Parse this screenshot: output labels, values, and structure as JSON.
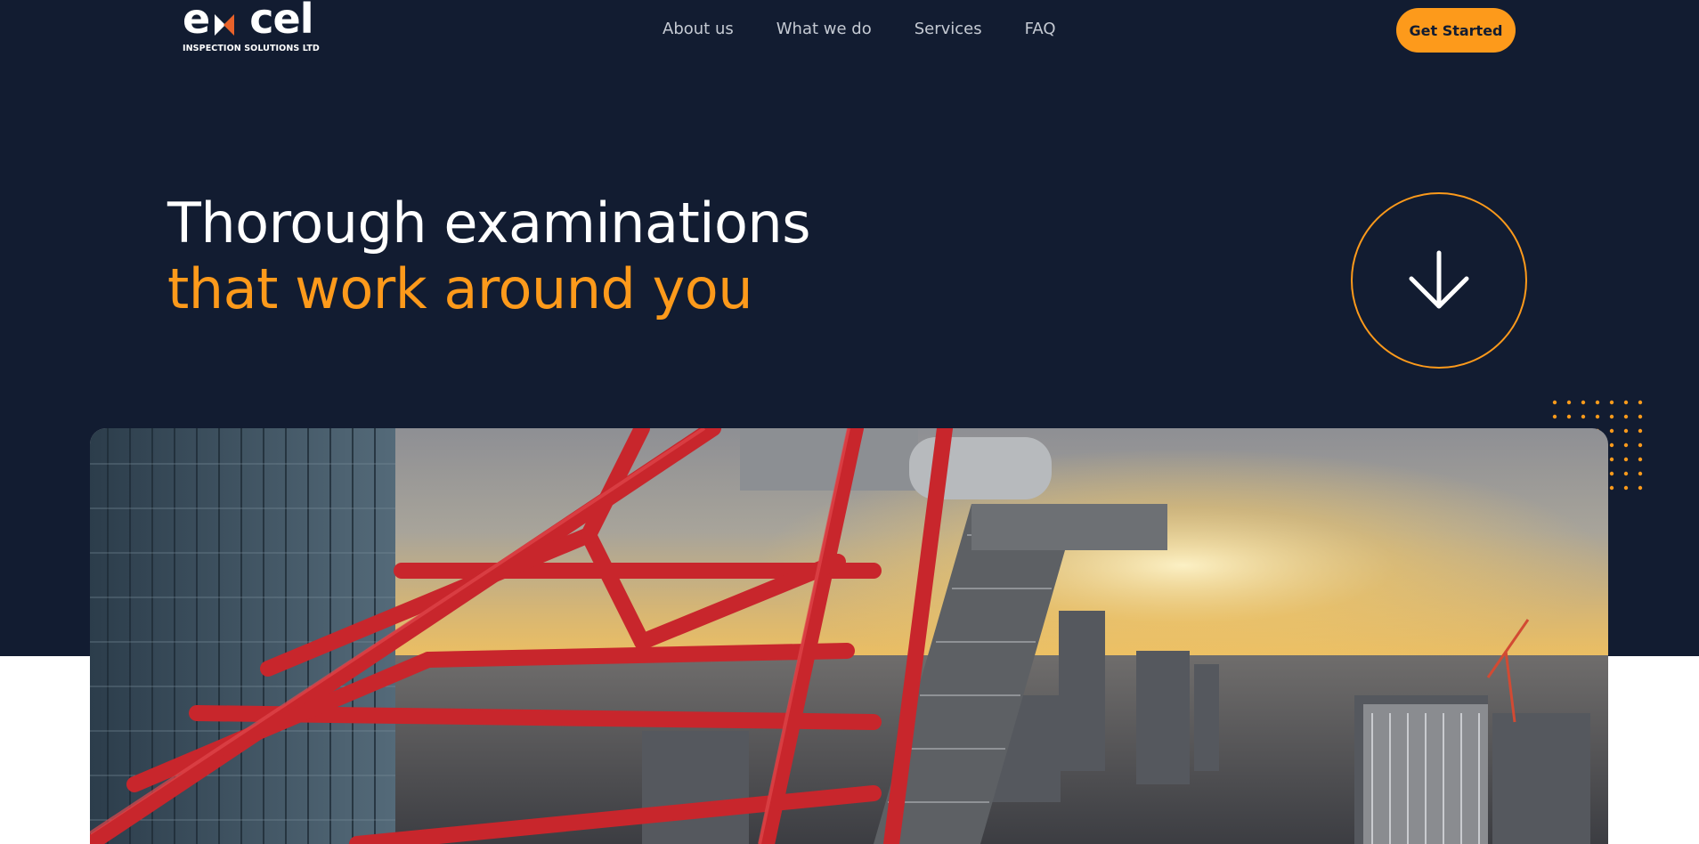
{
  "brand": {
    "logo_word": "excel",
    "logo_sub": "INSPECTION SOLUTIONS LTD"
  },
  "nav": {
    "items": [
      {
        "label": "About us"
      },
      {
        "label": "What we do"
      },
      {
        "label": "Services"
      },
      {
        "label": "FAQ"
      }
    ],
    "cta_label": "Get Started"
  },
  "hero": {
    "headline_line1": "Thorough examinations",
    "headline_line2": "that work around you",
    "scroll_icon": "arrow-down-icon",
    "image_description_icon": "crane-cityscape-photo"
  },
  "colors": {
    "background": "#121c31",
    "accent": "#fd9a1b",
    "nav_text": "#c5cad3",
    "headline": "#ffffff"
  }
}
